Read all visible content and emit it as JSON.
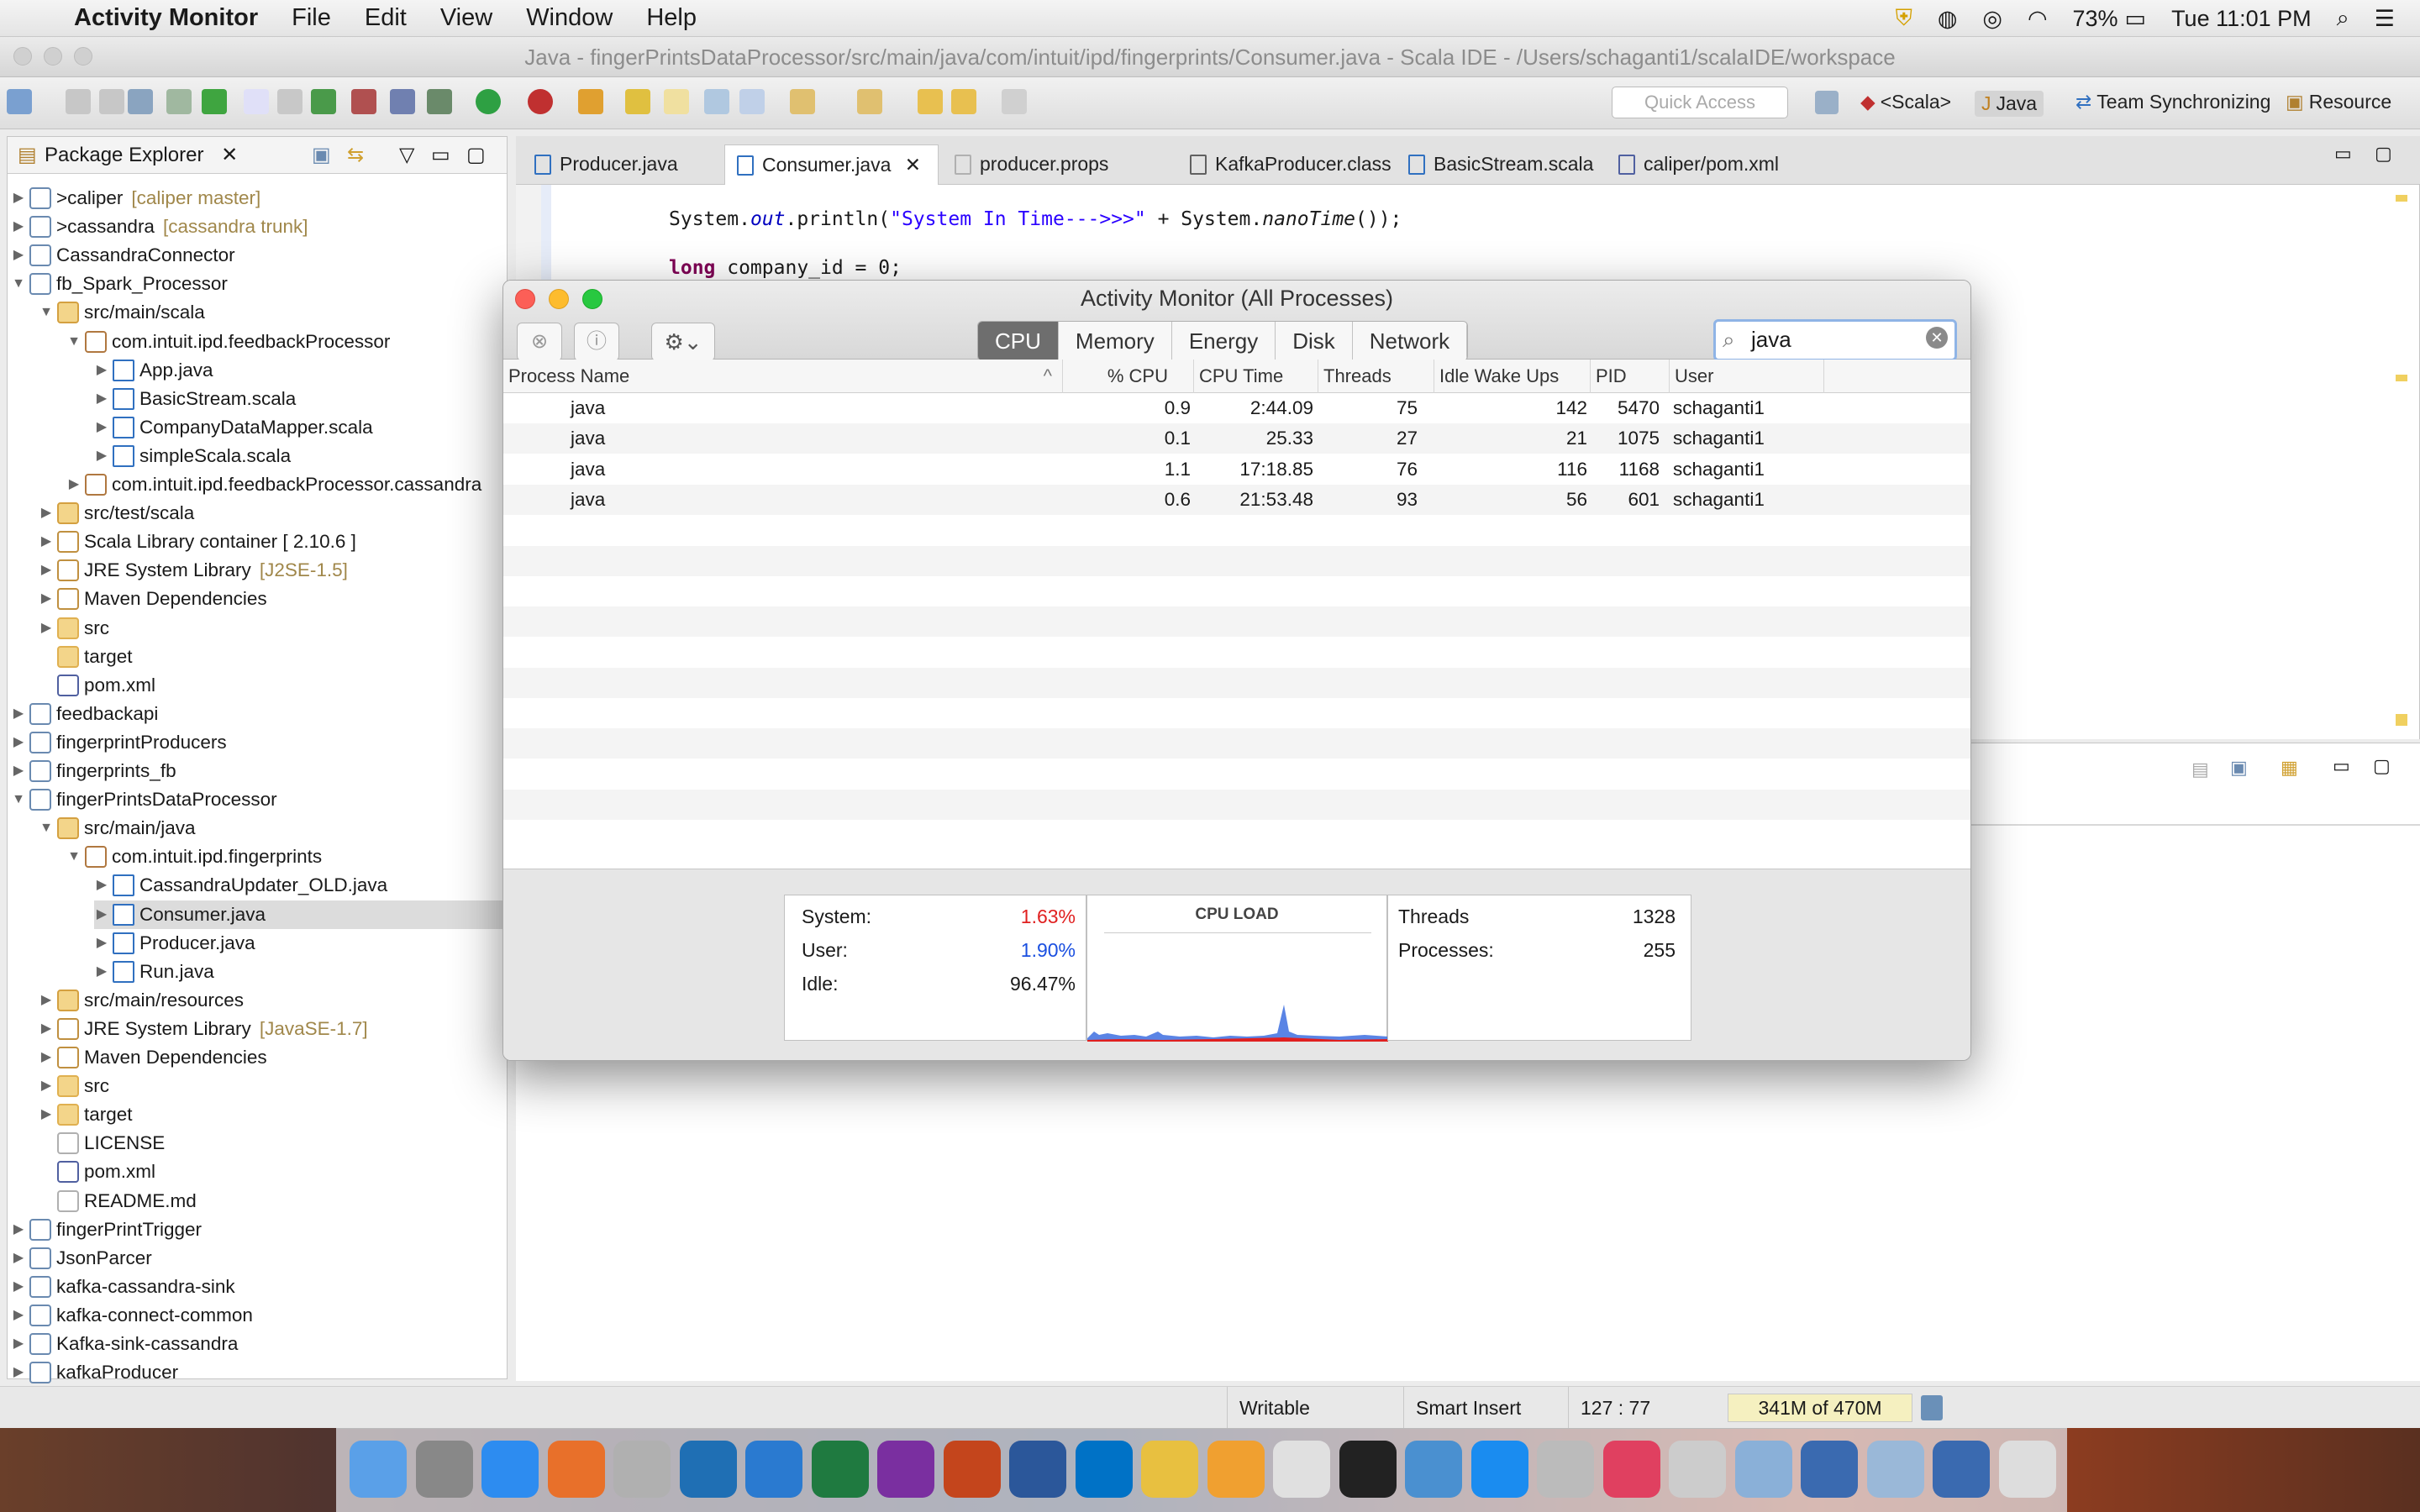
{
  "menubar": {
    "app_name": "Activity Monitor",
    "items": [
      "File",
      "Edit",
      "View",
      "Window",
      "Help"
    ],
    "battery": "73%",
    "clock": "Tue 11:01 PM"
  },
  "eclipse": {
    "window_title": "Java - fingerPrintsDataProcessor/src/main/java/com/intuit/ipd/fingerprints/Consumer.java - Scala IDE - /Users/schaganti1/scalaIDE/workspace",
    "quick_access": "Quick Access",
    "perspectives": [
      "<Scala>",
      "Java",
      "Team Synchronizing",
      "Resource"
    ],
    "explorer_title": "Package Explorer",
    "tree": [
      {
        "label": "caliper",
        "deco": "[caliper master]",
        "prefix": "> ",
        "depth": 0,
        "arrow": "right",
        "icon": "project"
      },
      {
        "label": "cassandra",
        "deco": "[cassandra trunk]",
        "prefix": "> ",
        "depth": 0,
        "arrow": "right",
        "icon": "project"
      },
      {
        "label": "CassandraConnector",
        "deco": "",
        "prefix": "",
        "depth": 0,
        "arrow": "right",
        "icon": "project"
      },
      {
        "label": "fb_Spark_Processor",
        "deco": "",
        "prefix": "",
        "depth": 0,
        "arrow": "down",
        "icon": "project"
      },
      {
        "label": "src/main/scala",
        "deco": "",
        "prefix": "",
        "depth": 1,
        "arrow": "down",
        "icon": "srcfolder"
      },
      {
        "label": "com.intuit.ipd.feedbackProcessor",
        "deco": "",
        "prefix": "",
        "depth": 2,
        "arrow": "down",
        "icon": "package"
      },
      {
        "label": "App.java",
        "deco": "",
        "prefix": "",
        "depth": 3,
        "arrow": "right",
        "icon": "java"
      },
      {
        "label": "BasicStream.scala",
        "deco": "",
        "prefix": "",
        "depth": 3,
        "arrow": "right",
        "icon": "scala"
      },
      {
        "label": "CompanyDataMapper.scala",
        "deco": "",
        "prefix": "",
        "depth": 3,
        "arrow": "right",
        "icon": "scala"
      },
      {
        "label": "simpleScala.scala",
        "deco": "",
        "prefix": "",
        "depth": 3,
        "arrow": "right",
        "icon": "scala"
      },
      {
        "label": "com.intuit.ipd.feedbackProcessor.cassandra",
        "deco": "",
        "prefix": "",
        "depth": 2,
        "arrow": "right",
        "icon": "package"
      },
      {
        "label": "src/test/scala",
        "deco": "",
        "prefix": "",
        "depth": 1,
        "arrow": "right",
        "icon": "srcfolder"
      },
      {
        "label": "Scala Library container [ 2.10.6 ]",
        "deco": "",
        "prefix": "",
        "depth": 1,
        "arrow": "right",
        "icon": "lib"
      },
      {
        "label": "JRE System Library",
        "deco": "[J2SE-1.5]",
        "prefix": "",
        "depth": 1,
        "arrow": "right",
        "icon": "lib"
      },
      {
        "label": "Maven Dependencies",
        "deco": "",
        "prefix": "",
        "depth": 1,
        "arrow": "right",
        "icon": "lib"
      },
      {
        "label": "src",
        "deco": "",
        "prefix": "",
        "depth": 1,
        "arrow": "right",
        "icon": "folder"
      },
      {
        "label": "target",
        "deco": "",
        "prefix": "",
        "depth": 1,
        "arrow": "",
        "icon": "folder"
      },
      {
        "label": "pom.xml",
        "deco": "",
        "prefix": "",
        "depth": 1,
        "arrow": "",
        "icon": "xml"
      },
      {
        "label": "feedbackapi",
        "deco": "",
        "prefix": "",
        "depth": 0,
        "arrow": "right",
        "icon": "project"
      },
      {
        "label": "fingerprintProducers",
        "deco": "",
        "prefix": "",
        "depth": 0,
        "arrow": "right",
        "icon": "project"
      },
      {
        "label": "fingerprints_fb",
        "deco": "",
        "prefix": "",
        "depth": 0,
        "arrow": "right",
        "icon": "project"
      },
      {
        "label": "fingerPrintsDataProcessor",
        "deco": "",
        "prefix": "",
        "depth": 0,
        "arrow": "down",
        "icon": "project"
      },
      {
        "label": "src/main/java",
        "deco": "",
        "prefix": "",
        "depth": 1,
        "arrow": "down",
        "icon": "srcfolder"
      },
      {
        "label": "com.intuit.ipd.fingerprints",
        "deco": "",
        "prefix": "",
        "depth": 2,
        "arrow": "down",
        "icon": "package"
      },
      {
        "label": "CassandraUpdater_OLD.java",
        "deco": "",
        "prefix": "",
        "depth": 3,
        "arrow": "right",
        "icon": "java"
      },
      {
        "label": "Consumer.java",
        "deco": "",
        "prefix": "",
        "depth": 3,
        "arrow": "right",
        "icon": "java",
        "selected": true
      },
      {
        "label": "Producer.java",
        "deco": "",
        "prefix": "",
        "depth": 3,
        "arrow": "right",
        "icon": "java"
      },
      {
        "label": "Run.java",
        "deco": "",
        "prefix": "",
        "depth": 3,
        "arrow": "right",
        "icon": "java"
      },
      {
        "label": "src/main/resources",
        "deco": "",
        "prefix": "",
        "depth": 1,
        "arrow": "right",
        "icon": "srcfolder"
      },
      {
        "label": "JRE System Library",
        "deco": "[JavaSE-1.7]",
        "prefix": "",
        "depth": 1,
        "arrow": "right",
        "icon": "lib"
      },
      {
        "label": "Maven Dependencies",
        "deco": "",
        "prefix": "",
        "depth": 1,
        "arrow": "right",
        "icon": "lib"
      },
      {
        "label": "src",
        "deco": "",
        "prefix": "",
        "depth": 1,
        "arrow": "right",
        "icon": "folder"
      },
      {
        "label": "target",
        "deco": "",
        "prefix": "",
        "depth": 1,
        "arrow": "right",
        "icon": "folder"
      },
      {
        "label": "LICENSE",
        "deco": "",
        "prefix": "",
        "depth": 1,
        "arrow": "",
        "icon": "file"
      },
      {
        "label": "pom.xml",
        "deco": "",
        "prefix": "",
        "depth": 1,
        "arrow": "",
        "icon": "xml"
      },
      {
        "label": "README.md",
        "deco": "",
        "prefix": "",
        "depth": 1,
        "arrow": "",
        "icon": "file"
      },
      {
        "label": "fingerPrintTrigger",
        "deco": "",
        "prefix": "",
        "depth": 0,
        "arrow": "right",
        "icon": "project"
      },
      {
        "label": "JsonParcer",
        "deco": "",
        "prefix": "",
        "depth": 0,
        "arrow": "right",
        "icon": "project"
      },
      {
        "label": "kafka-cassandra-sink",
        "deco": "",
        "prefix": "",
        "depth": 0,
        "arrow": "right",
        "icon": "project"
      },
      {
        "label": "kafka-connect-common",
        "deco": "",
        "prefix": "",
        "depth": 0,
        "arrow": "right",
        "icon": "project"
      },
      {
        "label": "Kafka-sink-cassandra",
        "deco": "",
        "prefix": "",
        "depth": 0,
        "arrow": "right",
        "icon": "project"
      },
      {
        "label": "kafkaProducer",
        "deco": "",
        "prefix": "",
        "depth": 0,
        "arrow": "right",
        "icon": "project"
      }
    ],
    "tabs": [
      {
        "label": "Producer.java",
        "icon": "java"
      },
      {
        "label": "Consumer.java",
        "icon": "java",
        "active": true
      },
      {
        "label": "producer.props",
        "icon": "file"
      },
      {
        "label": "KafkaProducer.class",
        "icon": "class"
      },
      {
        "label": "BasicStream.scala",
        "icon": "scala"
      },
      {
        "label": "caliper/pom.xml",
        "icon": "xml"
      }
    ],
    "code_line1_a": "System.",
    "code_line1_b": "out",
    "code_line1_c": ".println(",
    "code_line1_d": "\"System In Time--->>>\"",
    "code_line1_e": " + System.",
    "code_line1_f": "nanoTime",
    "code_line1_g": "());",
    "code_line2_a": "long",
    "code_line2_b": " company_id = 0;",
    "status": {
      "writable": "Writable",
      "insert": "Smart Insert",
      "position": "127 : 77",
      "heap": "341M of 470M"
    }
  },
  "activity_monitor": {
    "title": "Activity Monitor (All Processes)",
    "tabs": [
      "CPU",
      "Memory",
      "Energy",
      "Disk",
      "Network"
    ],
    "active_tab": "CPU",
    "search_value": "java",
    "columns": [
      "Process Name",
      "% CPU",
      "CPU Time",
      "Threads",
      "Idle Wake Ups",
      "PID",
      "User"
    ],
    "rows": [
      [
        "java",
        "0.9",
        "2:44.09",
        "75",
        "142",
        "5470",
        "schaganti1"
      ],
      [
        "java",
        "0.1",
        "25.33",
        "27",
        "21",
        "1075",
        "schaganti1"
      ],
      [
        "java",
        "1.1",
        "17:18.85",
        "76",
        "116",
        "1168",
        "schaganti1"
      ],
      [
        "java",
        "0.6",
        "21:53.48",
        "93",
        "56",
        "601",
        "schaganti1"
      ]
    ],
    "summary": {
      "system_label": "System:",
      "system_value": "1.63%",
      "user_label": "User:",
      "user_value": "1.90%",
      "idle_label": "Idle:",
      "idle_value": "96.47%",
      "cpu_load_label": "CPU LOAD",
      "threads_label": "Threads",
      "threads_value": "1328",
      "processes_label": "Processes:",
      "processes_value": "255"
    },
    "colors": {
      "system": "#e02020",
      "user": "#1a4fe0"
    }
  },
  "dock": {
    "apps": [
      "Finder",
      "System Preferences",
      "Safari",
      "Firefox",
      "Scala IDE",
      "Dell Defender",
      "Edge",
      "Excel",
      "OneNote",
      "PowerPoint",
      "Word",
      "Outlook",
      "Slack",
      "Photos",
      "Eclipse",
      "Terminal",
      "Activity Monitor",
      "App Store",
      "Remote",
      "iTunes",
      "Music Folder",
      "Preview",
      "Desktop",
      "Screenshot",
      "Finder Window",
      "Trash"
    ]
  }
}
